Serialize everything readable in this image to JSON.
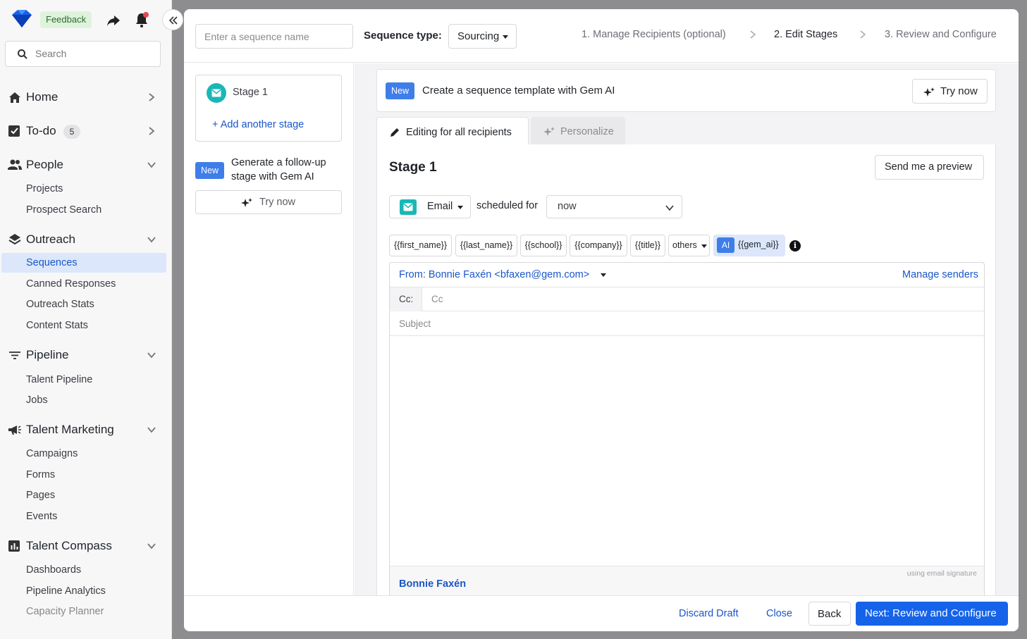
{
  "topbar": {
    "feedback_label": "Feedback"
  },
  "search": {
    "placeholder": "Search"
  },
  "nav": {
    "home": "Home",
    "todo": "To-do",
    "todo_count": "5",
    "people": "People",
    "people_items": [
      "Projects",
      "Prospect Search"
    ],
    "outreach": "Outreach",
    "outreach_items": [
      "Sequences",
      "Canned Responses",
      "Outreach Stats",
      "Content Stats"
    ],
    "pipeline": "Pipeline",
    "pipeline_items": [
      "Talent Pipeline",
      "Jobs"
    ],
    "talent_marketing": "Talent Marketing",
    "talent_marketing_items": [
      "Campaigns",
      "Forms",
      "Pages",
      "Events"
    ],
    "talent_compass": "Talent Compass",
    "talent_compass_items": [
      "Dashboards",
      "Pipeline Analytics",
      "Capacity Planner"
    ]
  },
  "header": {
    "sequence_name_placeholder": "Enter a sequence name",
    "sequence_type_label": "Sequence type:",
    "sequence_type_value": "Sourcing",
    "steps": [
      "1. Manage Recipients (optional)",
      "2. Edit Stages",
      "3. Review and Configure"
    ]
  },
  "stages": {
    "stage1_label": "Stage 1",
    "add_stage": "+ Add another stage",
    "new_tag": "New",
    "generate_text": "Generate a follow-up stage with Gem AI",
    "try_now": "Try now"
  },
  "banner": {
    "new_tag": "New",
    "text": "Create a sequence template with Gem AI",
    "try_now": "Try now"
  },
  "tabs": {
    "editing": "Editing for all recipients",
    "personalize": "Personalize"
  },
  "editor": {
    "stage_title": "Stage 1",
    "send_preview": "Send me a preview",
    "channel": "Email",
    "scheduled_for": "scheduled for",
    "when": "now",
    "tokens": [
      "{{first_name}}",
      "{{last_name}}",
      "{{school}}",
      "{{company}}",
      "{{title}}",
      "others"
    ],
    "ai_label": "AI",
    "ai_token": "{{gem_ai}}",
    "info_glyph": "i",
    "from": "From: Bonnie Faxén <bfaxen@gem.com>",
    "manage_senders": "Manage senders",
    "cc_label": "Cc:",
    "cc_placeholder": "Cc",
    "subject_placeholder": "Subject",
    "signature_note": "using email signature",
    "signature_name": "Bonnie Faxén"
  },
  "footer": {
    "discard": "Discard Draft",
    "close": "Close",
    "back": "Back",
    "next": "Next: Review and Configure"
  },
  "colors": {
    "accent": "#1563e8",
    "teal": "#1ab7b5",
    "active_bg": "#dce7fb"
  }
}
